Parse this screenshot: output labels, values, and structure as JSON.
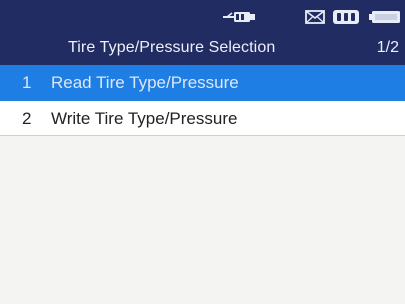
{
  "header": {
    "title": "Tire Type/Pressure Selection",
    "page_indicator": "1/2",
    "status_icons": [
      "usb-connection-icon",
      "mail-icon",
      "bluetooth-ble-icon",
      "battery-icon"
    ]
  },
  "menu": {
    "items": [
      {
        "number": "1",
        "label": "Read Tire Type/Pressure",
        "selected": true
      },
      {
        "number": "2",
        "label": "Write Tire Type/Pressure",
        "selected": false
      }
    ]
  },
  "colors": {
    "header_bg": "#202c62",
    "selected_bg": "#1f7ee3",
    "body_bg": "#f4f4f2"
  }
}
